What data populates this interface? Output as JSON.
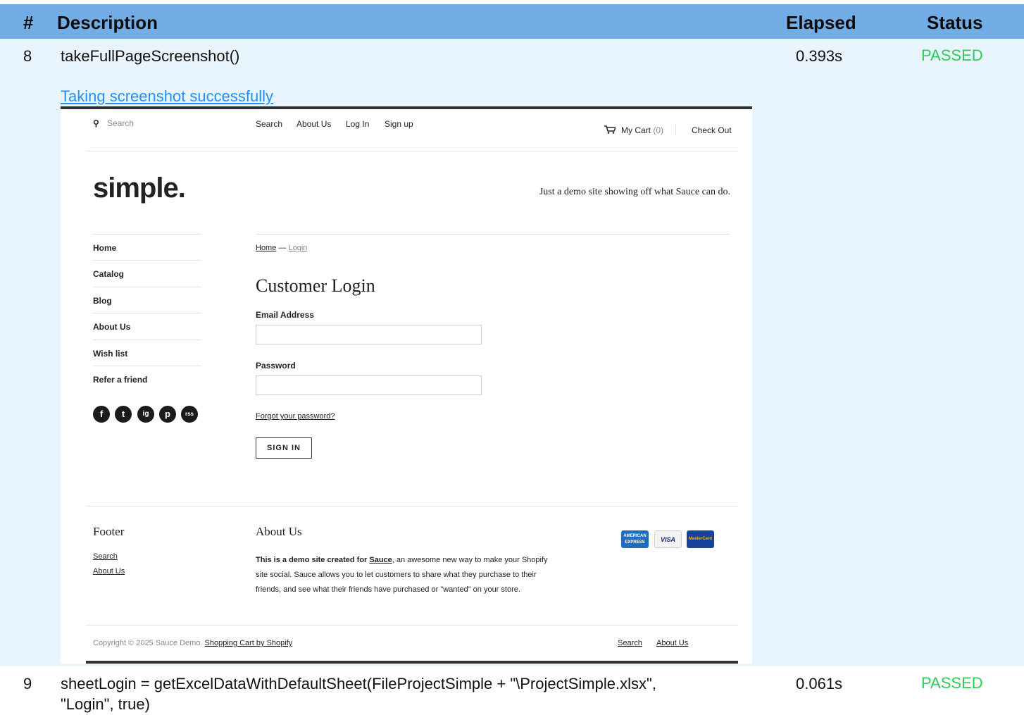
{
  "table_header": {
    "num": "#",
    "description": "Description",
    "elapsed": "Elapsed",
    "status": "Status"
  },
  "rows": [
    {
      "num": "8",
      "description": "takeFullPageScreenshot()",
      "elapsed": "0.393s",
      "status": "PASSED",
      "sublink": "Taking screenshot successfully"
    },
    {
      "num": "9",
      "description_line1": "sheetLogin = getExcelDataWithDefaultSheet(FileProjectSimple + \"\\ProjectSimple.xlsx\",",
      "description_line2": "\"Login\", true)",
      "elapsed": "0.061s",
      "status": "PASSED"
    }
  ],
  "shot": {
    "search_placeholder": "Search",
    "nav": [
      "Search",
      "About Us",
      "Log In",
      "Sign up"
    ],
    "cart_label": "My Cart",
    "cart_count": "(0)",
    "checkout": "Check Out",
    "logo": "simple.",
    "tagline": "Just a demo site showing off what Sauce can do.",
    "sidebar": [
      "Home",
      "Catalog",
      "Blog",
      "About Us",
      "Wish list",
      "Refer a friend"
    ],
    "social": [
      "f",
      "t",
      "ig",
      "p",
      "rss"
    ],
    "breadcrumb_home": "Home",
    "breadcrumb_sep": "—",
    "breadcrumb_current": "Login",
    "title": "Customer Login",
    "email_label": "Email Address",
    "password_label": "Password",
    "forgot": "Forgot your password?",
    "signin": "SIGN IN",
    "footer_heading": "Footer",
    "footer_links": [
      "Search",
      "About Us"
    ],
    "about_heading": "About Us",
    "about_bold": "This is a demo site created for ",
    "about_link": "Sauce",
    "about_rest1": ", an awesome new way to make your Shopify",
    "about_rest2": "site social. Sauce allows you to let customers to share what they purchase to their",
    "about_rest3": "friends, and see what their friends have purchased or \"wanted\" on your store.",
    "cards": [
      "AMERICAN EXPRESS",
      "VISA",
      "MasterCard"
    ],
    "copyright": "Copyright © 2025 Sauce Demo.",
    "shopify_link": "Shopping Cart by Shopify",
    "bottom_links": [
      "Search",
      "About Us"
    ]
  },
  "colors": {
    "header_bg": "#72ade5",
    "row_bg": "#e8f4fe",
    "passed": "#2ecc55",
    "link": "#1e90ff"
  }
}
